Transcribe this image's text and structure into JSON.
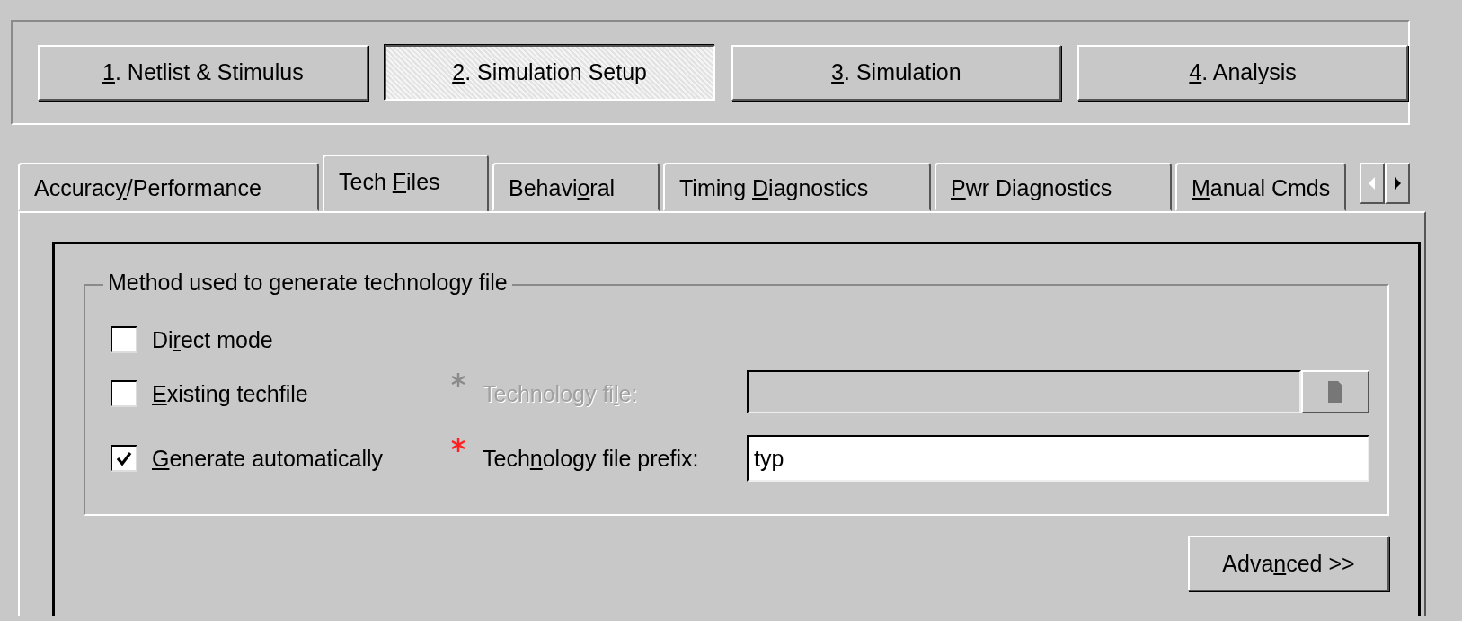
{
  "steps": [
    {
      "key": "1",
      "post": ". Netlist & Stimulus",
      "selected": false
    },
    {
      "key": "2",
      "post": ". Simulation Setup",
      "selected": true
    },
    {
      "key": "3",
      "post": ". Simulation",
      "selected": false
    },
    {
      "key": "4",
      "post": ". Analysis",
      "selected": false
    }
  ],
  "tabs": [
    {
      "pre": "Accurac",
      "key": "y",
      "post": "/Performance",
      "selected": false
    },
    {
      "pre": "Tech ",
      "key": "F",
      "post": "iles",
      "selected": true
    },
    {
      "pre": "Behavi",
      "key": "o",
      "post": "ral",
      "selected": false
    },
    {
      "pre": "Timing ",
      "key": "D",
      "post": "iagnostics",
      "selected": false
    },
    {
      "key": "P",
      "post": "wr Diagnostics",
      "selected": false
    },
    {
      "key": "M",
      "post": "anual Cmds",
      "selected": false
    }
  ],
  "tab_scroll": {
    "left_disabled": true,
    "right_disabled": false
  },
  "group": {
    "title": "Method used to generate technology file",
    "options": [
      {
        "pre": "Di",
        "key": "r",
        "post": "ect mode",
        "checked": false
      },
      {
        "key": "E",
        "post": "xisting techfile",
        "checked": false
      },
      {
        "key": "G",
        "post": "enerate automatically",
        "checked": true
      }
    ],
    "fields": [
      {
        "kind": "browse",
        "pre": "Technology fi",
        "key": "l",
        "post": "e:",
        "required": true,
        "disabled": true
      },
      {
        "kind": "text",
        "pre": "Tech",
        "key": "n",
        "post": "ology file prefix:",
        "required": true,
        "disabled": false,
        "value": "typ"
      }
    ]
  },
  "advanced_button": {
    "pre": "Adva",
    "key": "n",
    "post": "ced >>"
  }
}
